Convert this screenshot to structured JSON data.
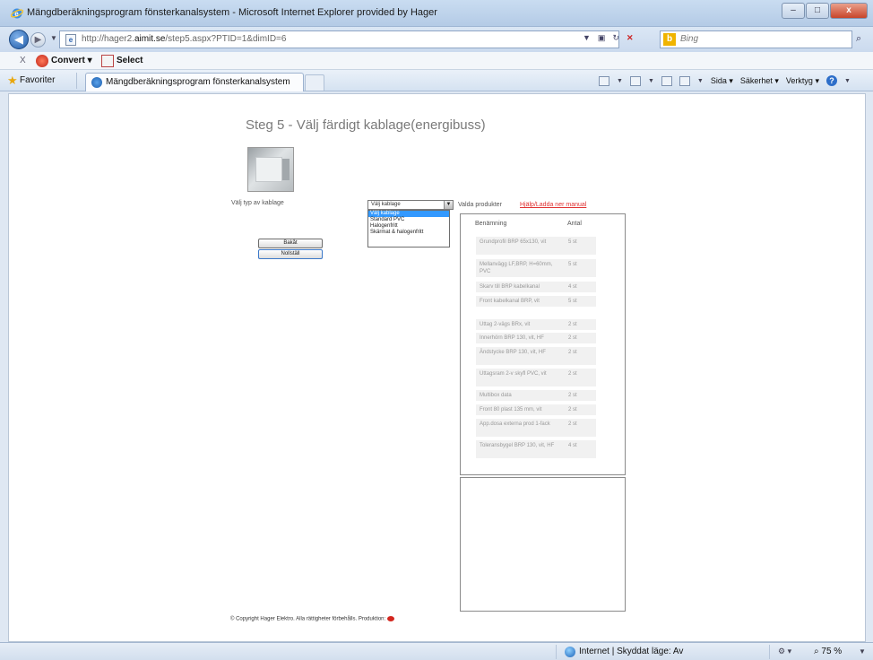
{
  "window": {
    "title": "Mängdberäkningsprogram fönsterkanalsystem - Microsoft Internet Explorer provided by Hager",
    "minimize": "–",
    "maximize": "□",
    "close": "x"
  },
  "address": {
    "url_prefix": "http://hager2.",
    "url_domain": "aimit.se",
    "url_suffix": "/step5.aspx?PTID=1&dimID=6",
    "search_placeholder": "Bing"
  },
  "toolbar": {
    "close": "X",
    "convert_label": "Convert",
    "select_label": "Select"
  },
  "favorites": {
    "label": "Favoriter",
    "tab_title": "Mängdberäkningsprogram fönsterkanalsystem"
  },
  "commands": {
    "page": "Sida",
    "safety": "Säkerhet",
    "tools": "Verktyg"
  },
  "page": {
    "title": "Steg 5 - Välj färdigt kablage(energibuss)",
    "cable_type_label": "Välj typ av kablage",
    "back_button": "Bakåt",
    "reset_button": "Nollställ",
    "select_value": "Välj kablage",
    "dropdown_options": [
      "Välj kablage",
      "Standard PVC",
      "Halogenfritt",
      "Skärmat & halogenfritt"
    ],
    "products_label": "Valda produkter",
    "manual_link": "Hjälp/Ladda ner manual",
    "table_header_name": "Benämning",
    "table_header_qty": "Antal",
    "products": [
      {
        "name": "Grundprofil BRP 65x130, vit",
        "qty": "5 st"
      },
      {
        "name": "Mellanvägg LF,BRP, H=60mm, PVC",
        "qty": "5 st"
      },
      {
        "name": "Skarv till BRP kabelkanal",
        "qty": "4 st"
      },
      {
        "name": "Front kabelkanal BRP, vit",
        "qty": "5 st"
      },
      {
        "name": "Uttag 2-vägs BRx, vit",
        "qty": "2 st"
      },
      {
        "name": "Innerhörn BRP 130, vit, HF",
        "qty": "2 st"
      },
      {
        "name": "Ändstycke BRP 130, vit, HF",
        "qty": "2 st"
      },
      {
        "name": "Uttagsram 2-v skyfl PVC, vit",
        "qty": "2 st"
      },
      {
        "name": "Multibox data",
        "qty": "2 st"
      },
      {
        "name": "Front 80 plast 135 mm, vit",
        "qty": "2 st"
      },
      {
        "name": "App.dosa externa prod 1-fack",
        "qty": "2 st"
      },
      {
        "name": "Toleransbygel BRP 130, vit, HF",
        "qty": "4 st"
      }
    ],
    "copyright": "© Copyright Hager Elektro. Alla rättigheter förbehålls. Produktion:"
  },
  "status": {
    "zone": "Internet | Skyddat läge: Av",
    "zoom": "75 %"
  }
}
